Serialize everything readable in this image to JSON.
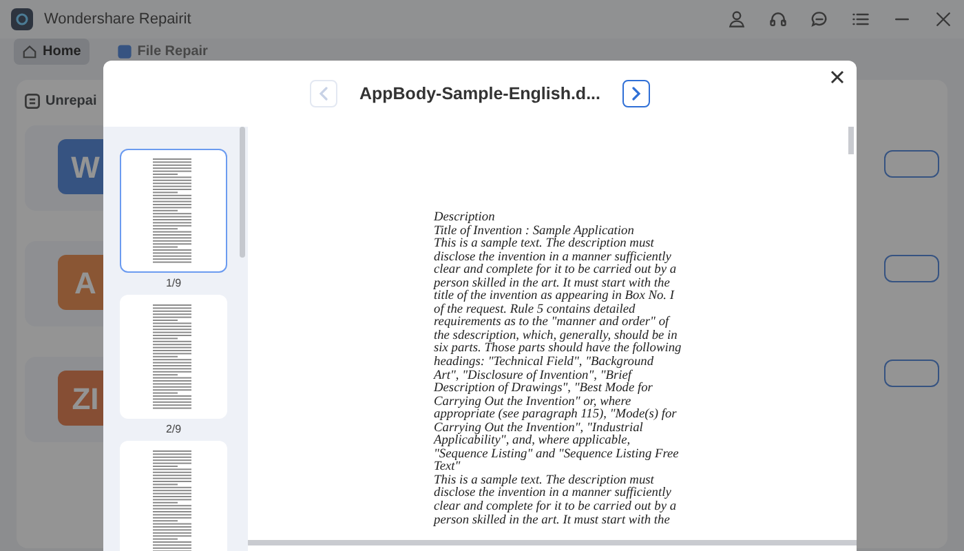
{
  "window": {
    "title": "Wondershare Repairit"
  },
  "tabs": [
    {
      "label": "Home",
      "selected": true
    },
    {
      "label": "File Repair",
      "selected": false
    }
  ],
  "panel": {
    "title": "Unrepai"
  },
  "file_tiles": [
    {
      "letter": "W",
      "kind": "word"
    },
    {
      "letter": "A",
      "kind": "pdf"
    },
    {
      "letter": "ZI",
      "kind": "zip"
    }
  ],
  "preview": {
    "title": "AppBody-Sample-English.d...",
    "prev_disabled": true,
    "next_disabled": false,
    "thumbnails": [
      {
        "label": "1/9",
        "selected": true
      },
      {
        "label": "2/9",
        "selected": false
      },
      {
        "selected": false
      }
    ],
    "document_lines": [
      "Description",
      "Title of Invention : Sample Application",
      "This is a sample text. The description must",
      "disclose the invention in a manner sufficiently",
      "clear and complete for it to be carried out by a",
      "person skilled in the art. It must start with the",
      "title of the invention as appearing in Box No. I",
      "of the request. Rule 5 contains detailed",
      "requirements as to the \"manner and order\" of",
      "the sdescription, which, generally, should be in",
      "six parts. Those parts should have the following",
      "headings: \"Technical Field\", \"Background",
      "Art\", \"Disclosure of Invention\", \"Brief",
      "Description of Drawings\", \"Best Mode for",
      "Carrying Out the Invention\" or, where",
      "appropriate (see paragraph 115), \"Mode(s) for",
      "Carrying Out the Invention\", \"Industrial",
      "Applicability\", and, where applicable,",
      "\"Sequence Listing\" and \"Sequence Listing Free",
      "Text\"",
      "This is a sample text. The description must",
      "disclose the invention in a manner sufficiently",
      "clear and complete for it to be carried out by a",
      "person skilled in the art. It must start with the"
    ]
  }
}
